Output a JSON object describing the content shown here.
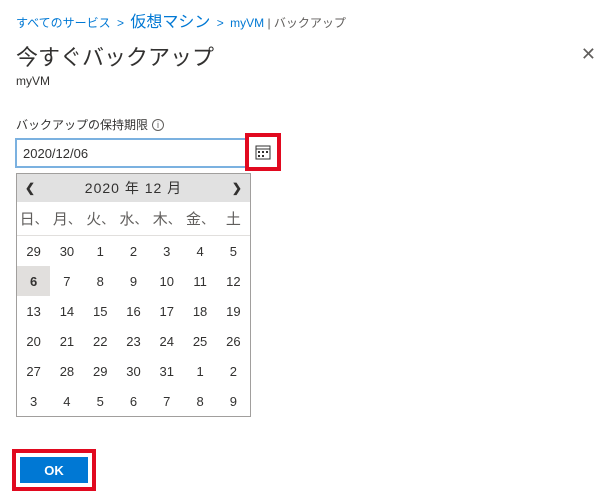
{
  "breadcrumb": {
    "all_services": "すべてのサービス",
    "vm": "仮想マシン",
    "resource": "myVM",
    "section": "バックアップ"
  },
  "header": {
    "title": "今すぐバックアップ",
    "subtitle": "myVM"
  },
  "field": {
    "label": "バックアップの保持期限",
    "value": "2020/12/06"
  },
  "calendar": {
    "title": "2020 年 12 月",
    "dow": [
      "日",
      "月",
      "火",
      "水",
      "木",
      "金",
      "土"
    ],
    "cells": [
      [
        "29",
        "30",
        "1",
        "2",
        "3",
        "4",
        "5"
      ],
      [
        "6",
        "7",
        "8",
        "9",
        "10",
        "11",
        "12"
      ],
      [
        "13",
        "14",
        "15",
        "16",
        "17",
        "18",
        "19"
      ],
      [
        "20",
        "21",
        "22",
        "23",
        "24",
        "25",
        "26"
      ],
      [
        "27",
        "28",
        "29",
        "30",
        "31",
        "1",
        "2"
      ],
      [
        "3",
        "4",
        "5",
        "6",
        "7",
        "8",
        "9"
      ]
    ],
    "selected": "6"
  },
  "footer": {
    "ok": "OK"
  }
}
